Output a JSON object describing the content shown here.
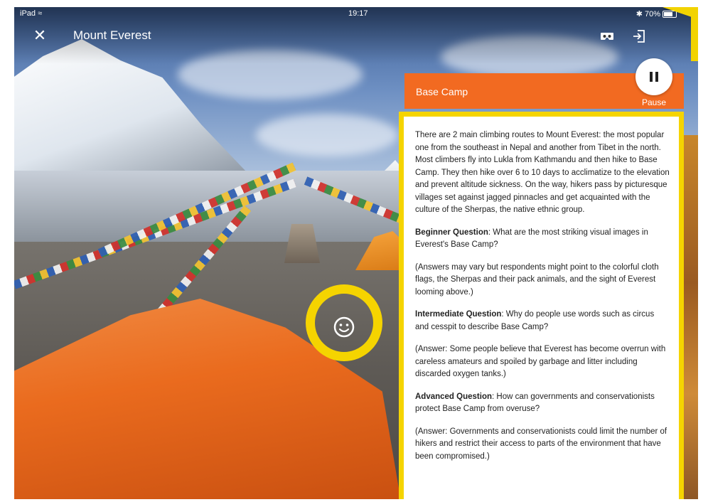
{
  "status_bar": {
    "device": "iPad",
    "time": "19:17",
    "battery": "70%"
  },
  "header": {
    "close_icon": "close-icon",
    "title": "Mount Everest",
    "vr_icon": "cardboard-vr-icon",
    "exit_icon": "exit-icon"
  },
  "panel": {
    "title": "Base Camp",
    "pause_label": "Pause",
    "intro": "There are 2 main climbing routes to Mount Everest: the most popular one from the southeast in Nepal and another from Tibet in the north. Most climbers fly into Lukla from Kathmandu and then hike to Base Camp. They then hike over 6 to 10 days to acclimatize to the elevation and prevent altitude sickness. On the way, hikers pass by picturesque villages set against jagged pinnacles and get acquainted with the culture of the Sherpas, the native ethnic group.",
    "questions": [
      {
        "level": "Beginner Question",
        "question": ": What are the most striking visual images in Everest's Base Camp?",
        "answer": "(Answers may vary but respondents might point to the colorful cloth flags, the Sherpas and their pack animals, and the sight of Everest looming above.)"
      },
      {
        "level": "Intermediate Question",
        "question": ": Why do people use words such as circus and cesspit to describe Base Camp?",
        "answer": "(Answer: Some people believe that Everest has become overrun with careless amateurs and spoiled by garbage and litter including discarded oxygen tanks.)"
      },
      {
        "level": "Advanced Question",
        "question": ": How can governments and conservationists protect Base Camp from overuse?",
        "answer": "(Answer: Governments and conservationists could limit the number of hikers and restrict their access to parts of the environment that have been compromised.)"
      }
    ]
  },
  "colors": {
    "panel_header": "#f26a21",
    "highlight": "#f5d400"
  },
  "focus": {
    "icon": "smiley-icon"
  }
}
